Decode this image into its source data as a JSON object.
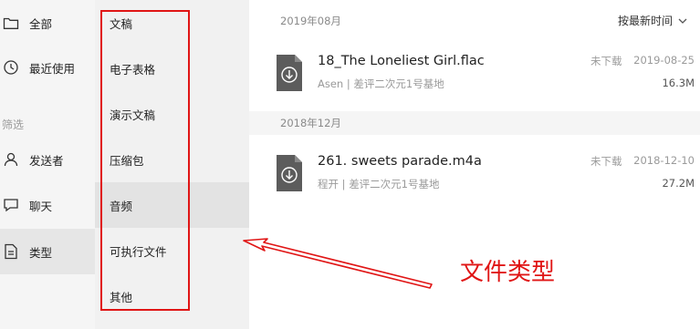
{
  "nav": {
    "items": [
      {
        "label": "全部",
        "icon": "folder-icon"
      },
      {
        "label": "最近使用",
        "icon": "clock-icon"
      }
    ],
    "section_label": "筛选",
    "filters": [
      {
        "label": "发送者",
        "icon": "person-icon"
      },
      {
        "label": "聊天",
        "icon": "chat-icon"
      },
      {
        "label": "类型",
        "icon": "document-icon",
        "selected": true
      }
    ]
  },
  "submenu": {
    "items": [
      {
        "label": "文稿"
      },
      {
        "label": "电子表格"
      },
      {
        "label": "演示文稿"
      },
      {
        "label": "压缩包"
      },
      {
        "label": "音频",
        "selected": true
      },
      {
        "label": "可执行文件"
      },
      {
        "label": "其他"
      }
    ]
  },
  "main": {
    "sort_label": "按最新时间",
    "groups": [
      {
        "header": "2019年08月",
        "files": [
          {
            "name": "18_The Loneliest Girl.flac",
            "sender": "Asen",
            "chat": "差评二次元1号基地",
            "status": "未下载",
            "date": "2019-08-25",
            "size": "16.3M"
          }
        ]
      },
      {
        "header": "2018年12月",
        "files": [
          {
            "name": "261. sweets parade.m4a",
            "sender": "程开",
            "chat": "差评二次元1号基地",
            "status": "未下载",
            "date": "2018-12-10",
            "size": "27.2M"
          }
        ]
      }
    ]
  },
  "annotation": {
    "label": "文件类型",
    "color": "#e01515"
  }
}
